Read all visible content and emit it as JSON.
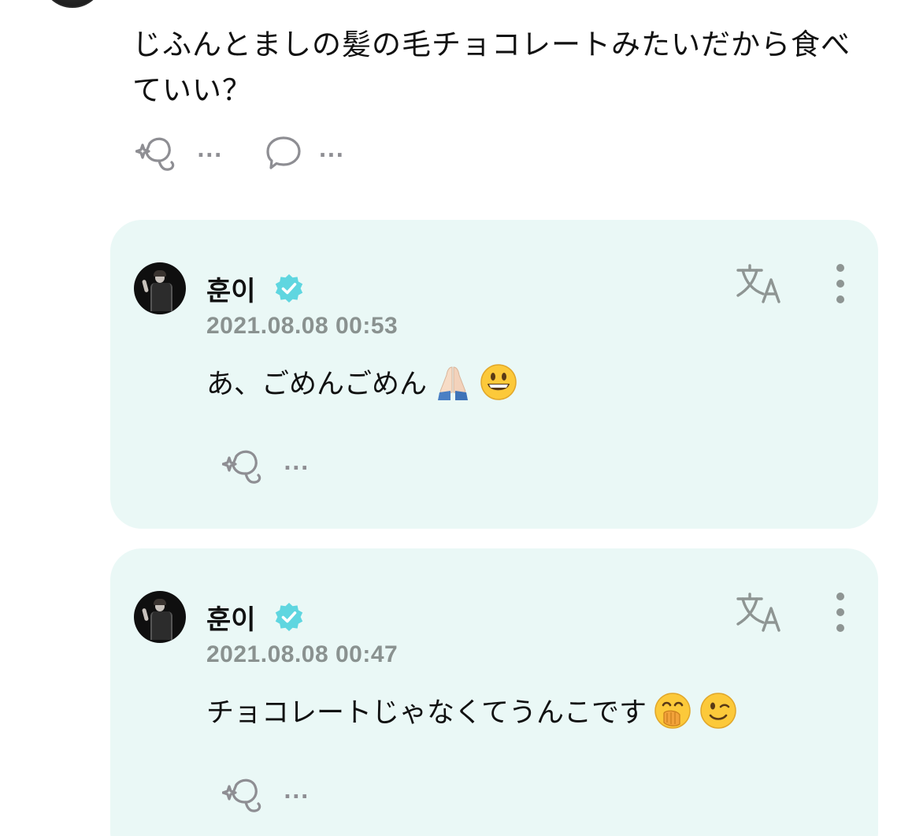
{
  "post": {
    "text": "じふんとましの髪の毛チョコレートみたいだから食べていい？",
    "like_count": "...",
    "comment_count": "..."
  },
  "replies": [
    {
      "name": "훈이",
      "date": "2021.08.08 00:53",
      "text": "あ、ごめんごめん",
      "emojis": [
        "folded-hands-emoji",
        "grinning-face-emoji"
      ],
      "like_count": "..."
    },
    {
      "name": "훈이",
      "date": "2021.08.08 00:47",
      "text": "チョコレートじゃなくてうんこです",
      "emojis": [
        "hand-over-mouth-emoji",
        "winking-face-emoji"
      ],
      "like_count": "..."
    }
  ],
  "colors": {
    "card_background": "#eaf8f6",
    "verified_badge": "#5fd6e0",
    "icon_gray": "#8e8e93",
    "date_gray": "#8a9290"
  },
  "icons": {
    "like": "sparkle-heart-icon",
    "comment": "speech-bubble-icon",
    "translate": "translate-icon",
    "more": "more-vertical-icon",
    "verified": "verified-badge-icon"
  }
}
